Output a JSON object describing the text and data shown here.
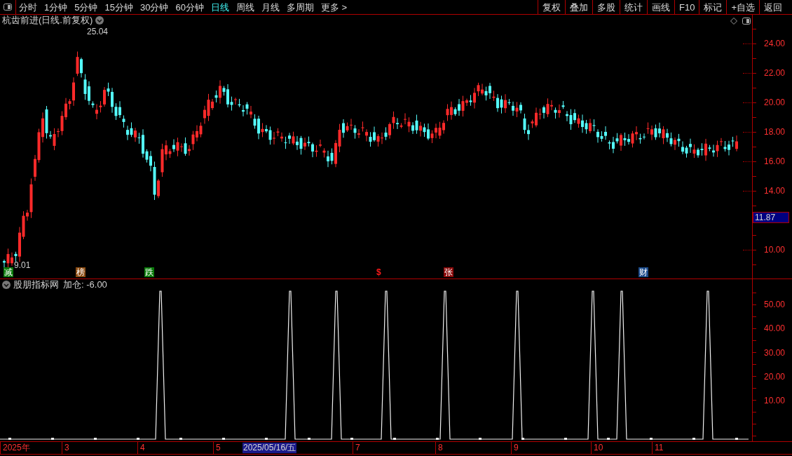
{
  "toolbar": {
    "periods": [
      {
        "label": "分时",
        "selected": false
      },
      {
        "label": "1分钟",
        "selected": false
      },
      {
        "label": "5分钟",
        "selected": false
      },
      {
        "label": "15分钟",
        "selected": false
      },
      {
        "label": "30分钟",
        "selected": false
      },
      {
        "label": "60分钟",
        "selected": false
      },
      {
        "label": "日线",
        "selected": true
      },
      {
        "label": "周线",
        "selected": false
      },
      {
        "label": "月线",
        "selected": false
      },
      {
        "label": "多周期",
        "selected": false
      },
      {
        "label": "更多 >",
        "selected": false
      }
    ],
    "actions": [
      "复权",
      "叠加",
      "多股",
      "统计",
      "画线",
      "F10",
      "标记",
      "+自选",
      "返回"
    ]
  },
  "chart": {
    "title": "杭齿前进(日线.前复权)",
    "high_label": "25.04",
    "low_label": "9.01",
    "price_axis": [
      "24.00",
      "22.00",
      "20.00",
      "18.00",
      "16.00",
      "14.00",
      "10.00"
    ],
    "current_price": "11.87",
    "markers": [
      {
        "label": "减",
        "kind": "badge",
        "color": "#0a7a0a"
      },
      {
        "label": "榜",
        "kind": "badge",
        "color": "#8a4a10"
      },
      {
        "label": "跌",
        "kind": "badge",
        "color": "#0a7a0a"
      },
      {
        "label": "$",
        "kind": "text",
        "color": "#ff1a1a"
      },
      {
        "label": "张",
        "kind": "badge",
        "color": "#8a0a0a"
      },
      {
        "label": "财",
        "kind": "badge",
        "color": "#1a4a8a"
      }
    ]
  },
  "indicator": {
    "name": "股朋指标网",
    "reading": "加仓: -6.00",
    "axis": [
      "50.00",
      "40.00",
      "30.00",
      "20.00",
      "10.00"
    ]
  },
  "date_axis": [
    {
      "label": "2025年",
      "selected": false
    },
    {
      "label": "3",
      "selected": false
    },
    {
      "label": "4",
      "selected": false
    },
    {
      "label": "5",
      "selected": false
    },
    {
      "label": "2025/05/16/五",
      "selected": true
    },
    {
      "label": "7",
      "selected": false
    },
    {
      "label": "8",
      "selected": false
    },
    {
      "label": "9",
      "selected": false
    },
    {
      "label": "10",
      "selected": false
    },
    {
      "label": "11",
      "selected": false
    }
  ]
}
